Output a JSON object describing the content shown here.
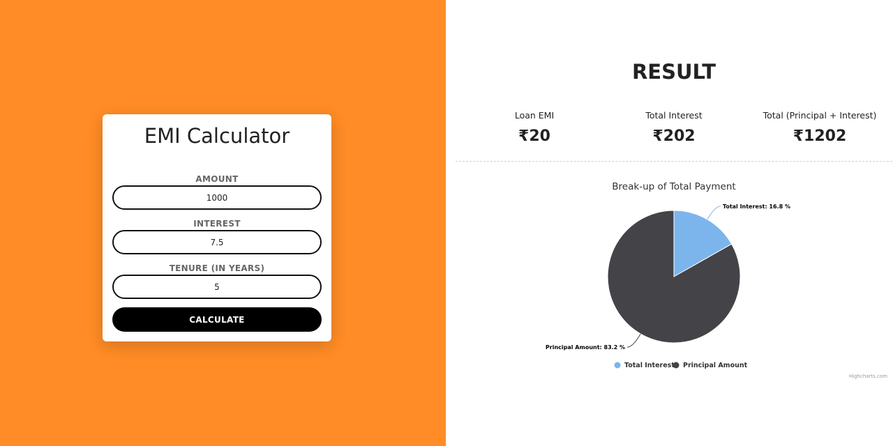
{
  "calculator": {
    "title": "EMI Calculator",
    "amount": {
      "label": "AMOUNT",
      "value": "1000"
    },
    "interest": {
      "label": "INTEREST",
      "value": "7.5"
    },
    "tenure": {
      "label": "TENURE (IN YEARS)",
      "value": "5"
    },
    "calculate_label": "CALCULATE"
  },
  "result": {
    "title": "RESULT",
    "stats": [
      {
        "label": "Loan EMI",
        "value": "₹20"
      },
      {
        "label": "Total Interest",
        "value": "₹202"
      },
      {
        "label": "Total (Principal + Interest)",
        "value": "₹1202"
      }
    ]
  },
  "credits": "Highcharts.com",
  "colors": {
    "accent": "#FF8C26",
    "interest": "#7CB5EC",
    "principal": "#434348"
  },
  "chart_data": {
    "type": "pie",
    "title": "Break-up of Total Payment",
    "series": [
      {
        "name": "Total Interest",
        "value": 16.8,
        "label": "Total Interest: 16.8 %",
        "color": "#7CB5EC"
      },
      {
        "name": "Principal Amount",
        "value": 83.2,
        "label": "Principal Amount: 83.2 %",
        "color": "#434348"
      }
    ],
    "legend": [
      "Total Interest",
      "Principal Amount"
    ],
    "legend_position": "bottom"
  }
}
